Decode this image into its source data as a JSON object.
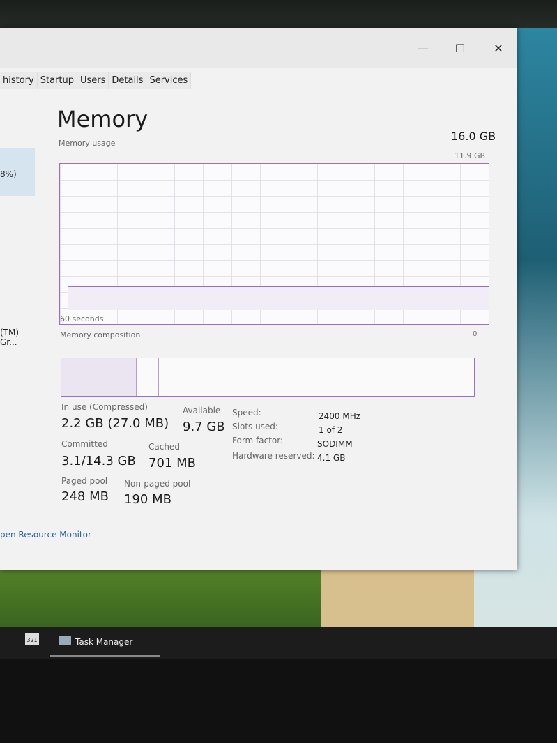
{
  "window": {
    "minimize": "—",
    "maximize": "☐",
    "close": "✕"
  },
  "tabs": [
    "history",
    "Startup",
    "Users",
    "Details",
    "Services"
  ],
  "sidebar": {
    "item1": "8%)",
    "item2": "(TM) Gr..."
  },
  "memory": {
    "title": "Memory",
    "total": "16.0 GB",
    "usage_label": "Memory usage",
    "usage_max": "11.9 GB",
    "time_label": "60 seconds",
    "min_label": "0",
    "composition_label": "Memory composition",
    "usage_fraction": 0.15,
    "in_use_label": "In use (Compressed)",
    "in_use": "2.2 GB (27.0 MB)",
    "available_label": "Available",
    "available": "9.7 GB",
    "committed_label": "Committed",
    "committed": "3.1/14.3 GB",
    "cached_label": "Cached",
    "cached": "701 MB",
    "paged_label": "Paged pool",
    "paged": "248 MB",
    "nonpaged_label": "Non-paged pool",
    "nonpaged": "190 MB",
    "speed_label": "Speed:",
    "speed": "2400 MHz",
    "slots_label": "Slots used:",
    "slots": "1 of 2",
    "form_label": "Form factor:",
    "form": "SODIMM",
    "hw_label": "Hardware reserved:",
    "hw": "4.1 GB",
    "accent": "#9b6fc2"
  },
  "footer": {
    "resource_monitor": "pen Resource Monitor"
  },
  "taskbar": {
    "task_manager": "Task Manager",
    "calendar": "321"
  }
}
